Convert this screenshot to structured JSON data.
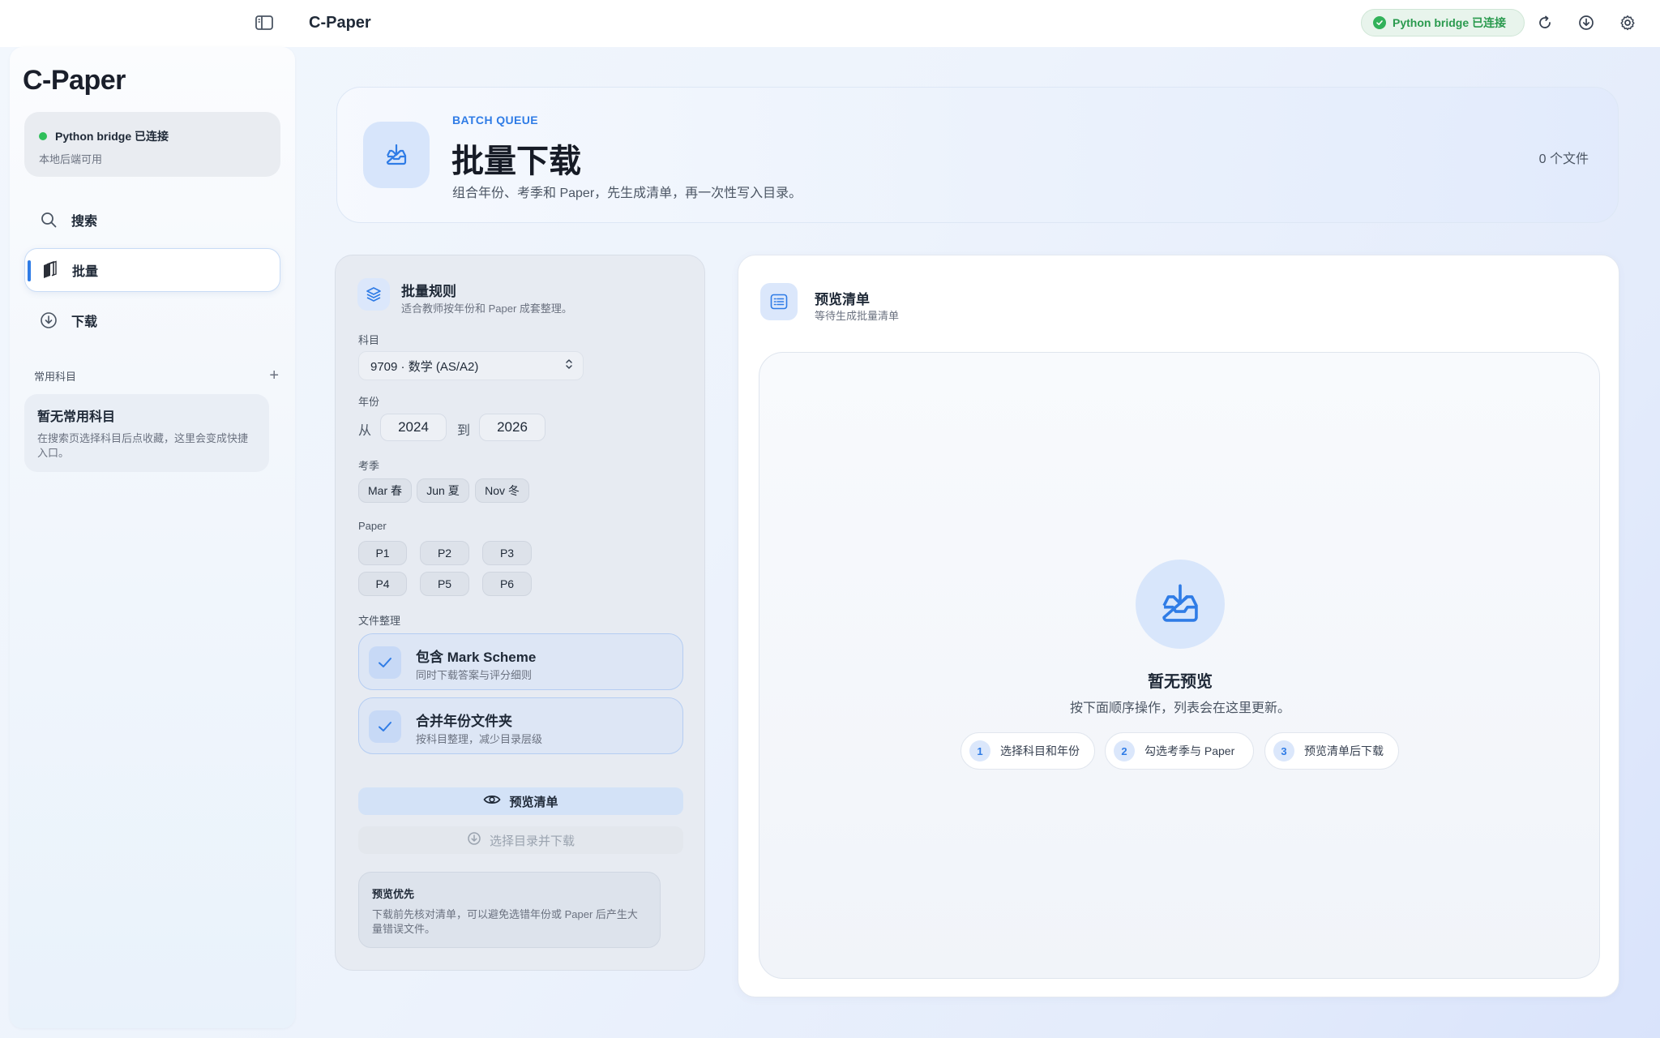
{
  "titlebar": {
    "app_title": "C-Paper",
    "status": "Python bridge 已连接",
    "icons": [
      "sidebar-toggle-icon",
      "refresh-icon",
      "download-icon",
      "settings-icon"
    ]
  },
  "sidebar": {
    "logo": "C-Paper",
    "bridge": {
      "status": "Python bridge 已连接",
      "sub": "本地后端可用",
      "status_color": "#2fbf5a"
    },
    "nav": [
      {
        "label": "搜索",
        "icon": "search-icon"
      },
      {
        "label": "批量",
        "icon": "batch-icon",
        "active": true
      },
      {
        "label": "下载",
        "icon": "download-circle-icon"
      }
    ],
    "favorites": {
      "header": "常用科目",
      "add": "+",
      "empty_title": "暂无常用科目",
      "empty_desc": "在搜索页选择科目后点收藏，这里会变成快捷入口。"
    }
  },
  "header": {
    "eyebrow": "BATCH QUEUE",
    "title": "批量下载",
    "desc": "组合年份、考季和 Paper，先生成清单，再一次性写入目录。",
    "count": "0 个文件"
  },
  "rules": {
    "title": "批量规则",
    "sub": "适合教师按年份和 Paper 成套整理。",
    "subject_label": "科目",
    "subject_value": "9709 · 数学 (AS/A2)",
    "year_label": "年份",
    "year_from_label": "从",
    "year_from": "2024",
    "year_to_label": "到",
    "year_to": "2026",
    "season_label": "考季",
    "seasons": [
      "Mar 春",
      "Jun 夏",
      "Nov 冬"
    ],
    "paper_label": "Paper",
    "papers": [
      "P1",
      "P2",
      "P3",
      "P4",
      "P5",
      "P6"
    ],
    "organize_label": "文件整理",
    "toggles": [
      {
        "title": "包含 Mark Scheme",
        "sub": "同时下载答案与评分细则",
        "checked": true
      },
      {
        "title": "合并年份文件夹",
        "sub": "按科目整理，减少目录层级",
        "checked": true
      }
    ],
    "preview_button": "预览清单",
    "download_button": "选择目录并下载",
    "tip_title": "预览优先",
    "tip_desc": "下载前先核对清单，可以避免选错年份或 Paper 后产生大量错误文件。"
  },
  "preview": {
    "title": "预览清单",
    "sub": "等待生成批量清单",
    "empty_title": "暂无预览",
    "empty_desc": "按下面顺序操作，列表会在这里更新。",
    "steps": [
      {
        "num": "1",
        "label": "选择科目和年份"
      },
      {
        "num": "2",
        "label": "勾选考季与 Paper"
      },
      {
        "num": "3",
        "label": "预览清单后下载"
      }
    ]
  },
  "colors": {
    "accent": "#2f7ce6",
    "success": "#2fbf5a"
  }
}
